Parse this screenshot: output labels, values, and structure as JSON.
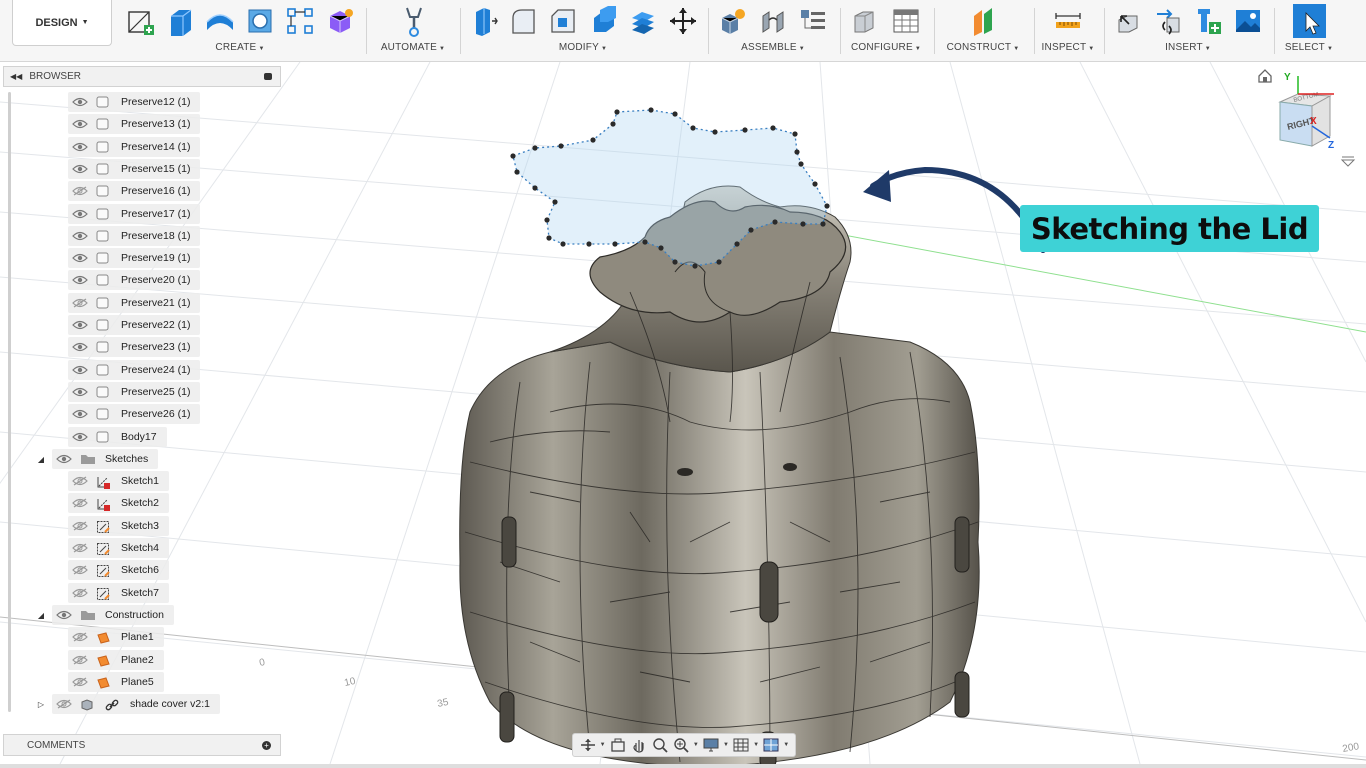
{
  "toolbar": {
    "workspace": "DESIGN",
    "groups": [
      {
        "label": "CREATE"
      },
      {
        "label": "AUTOMATE"
      },
      {
        "label": "MODIFY"
      },
      {
        "label": "ASSEMBLE"
      },
      {
        "label": "CONFIGURE"
      },
      {
        "label": "CONSTRUCT"
      },
      {
        "label": "INSPECT"
      },
      {
        "label": "INSERT"
      },
      {
        "label": "SELECT"
      }
    ]
  },
  "browser": {
    "title": "BROWSER",
    "items": [
      {
        "label": "Preserve12 (1)",
        "type": "body",
        "visible": true
      },
      {
        "label": "Preserve13 (1)",
        "type": "body",
        "visible": true
      },
      {
        "label": "Preserve14 (1)",
        "type": "body",
        "visible": true
      },
      {
        "label": "Preserve15 (1)",
        "type": "body",
        "visible": true
      },
      {
        "label": "Preserve16 (1)",
        "type": "body",
        "visible": false
      },
      {
        "label": "Preserve17 (1)",
        "type": "body",
        "visible": true
      },
      {
        "label": "Preserve18 (1)",
        "type": "body",
        "visible": true
      },
      {
        "label": "Preserve19 (1)",
        "type": "body",
        "visible": true
      },
      {
        "label": "Preserve20 (1)",
        "type": "body",
        "visible": true
      },
      {
        "label": "Preserve21 (1)",
        "type": "body",
        "visible": false
      },
      {
        "label": "Preserve22 (1)",
        "type": "body",
        "visible": true
      },
      {
        "label": "Preserve23 (1)",
        "type": "body",
        "visible": true
      },
      {
        "label": "Preserve24 (1)",
        "type": "body",
        "visible": true
      },
      {
        "label": "Preserve25 (1)",
        "type": "body",
        "visible": true
      },
      {
        "label": "Preserve26 (1)",
        "type": "body",
        "visible": true
      },
      {
        "label": "Body17",
        "type": "body",
        "visible": true
      }
    ],
    "sketches_folder": "Sketches",
    "sketches": [
      {
        "label": "Sketch1",
        "type": "sketch-locked"
      },
      {
        "label": "Sketch2",
        "type": "sketch-locked"
      },
      {
        "label": "Sketch3",
        "type": "sketch"
      },
      {
        "label": "Sketch4",
        "type": "sketch"
      },
      {
        "label": "Sketch6",
        "type": "sketch"
      },
      {
        "label": "Sketch7",
        "type": "sketch"
      }
    ],
    "construction_folder": "Construction",
    "planes": [
      {
        "label": "Plane1"
      },
      {
        "label": "Plane2"
      },
      {
        "label": "Plane5"
      }
    ],
    "component": "shade cover v2:1"
  },
  "comments": {
    "title": "COMMENTS"
  },
  "callout": {
    "text": "Sketching the Lid"
  },
  "viewcube": {
    "face_right": "RIGHT",
    "face_top": "BOTTOM",
    "axis_x": "X",
    "axis_y": "Y",
    "axis_z": "Z"
  },
  "grid_ticks": [
    "0",
    "10",
    "35",
    "200"
  ],
  "colors": {
    "callout": "#3ed2d6",
    "arrow": "#1f3a68",
    "sketch_line": "#3a7fc1"
  }
}
